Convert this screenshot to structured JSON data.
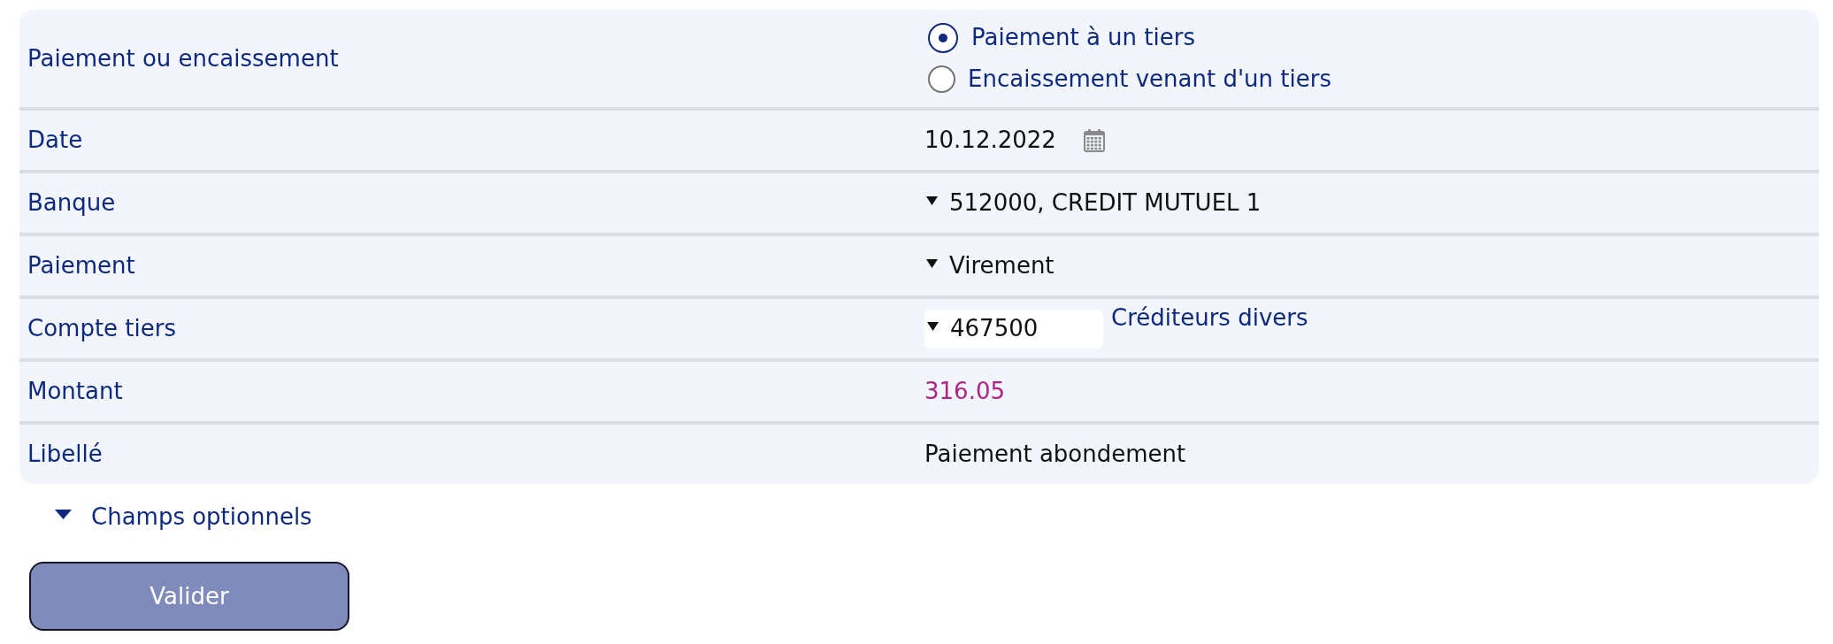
{
  "form": {
    "rows": [
      {
        "label": "Paiement ou encaissement",
        "kind": "radio",
        "options": [
          {
            "label": "Paiement à un tiers",
            "selected": true
          },
          {
            "label": "Encaissement venant d'un tiers",
            "selected": false
          }
        ]
      },
      {
        "label": "Date",
        "kind": "date",
        "value": "10.12.2022"
      },
      {
        "label": "Banque",
        "kind": "select",
        "value": "512000, CREDIT MUTUEL 1"
      },
      {
        "label": "Paiement",
        "kind": "select",
        "value": "Virement"
      },
      {
        "label": "Compte tiers",
        "kind": "account",
        "value": "467500",
        "description": "Créditeurs divers"
      },
      {
        "label": "Montant",
        "kind": "amount",
        "value": "316.05"
      },
      {
        "label": "Libellé",
        "kind": "text",
        "value": "Paiement abondement"
      }
    ]
  },
  "optional_fields": {
    "label": "Champs optionnels"
  },
  "submit_button": {
    "label": "Valider"
  }
}
